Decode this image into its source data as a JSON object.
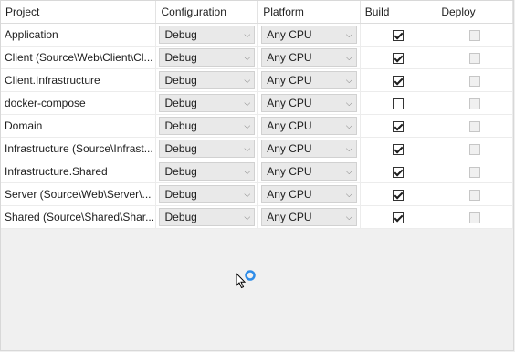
{
  "columns": {
    "project": "Project",
    "configuration": "Configuration",
    "platform": "Platform",
    "build": "Build",
    "deploy": "Deploy"
  },
  "rows": [
    {
      "project": "Application",
      "configuration": "Debug",
      "platform": "Any CPU",
      "build": true,
      "deploy": false
    },
    {
      "project": "Client (Source\\Web\\Client\\Cl...",
      "configuration": "Debug",
      "platform": "Any CPU",
      "build": true,
      "deploy": false
    },
    {
      "project": "Client.Infrastructure",
      "configuration": "Debug",
      "platform": "Any CPU",
      "build": true,
      "deploy": false
    },
    {
      "project": "docker-compose",
      "configuration": "Debug",
      "platform": "Any CPU",
      "build": false,
      "deploy": false
    },
    {
      "project": "Domain",
      "configuration": "Debug",
      "platform": "Any CPU",
      "build": true,
      "deploy": false
    },
    {
      "project": "Infrastructure (Source\\Infrast...",
      "configuration": "Debug",
      "platform": "Any CPU",
      "build": true,
      "deploy": false
    },
    {
      "project": "Infrastructure.Shared",
      "configuration": "Debug",
      "platform": "Any CPU",
      "build": true,
      "deploy": false
    },
    {
      "project": "Server (Source\\Web\\Server\\...",
      "configuration": "Debug",
      "platform": "Any CPU",
      "build": true,
      "deploy": false
    },
    {
      "project": "Shared (Source\\Shared\\Shar...",
      "configuration": "Debug",
      "platform": "Any CPU",
      "build": true,
      "deploy": false
    }
  ],
  "icons": {
    "dropdown": "chevron-down-icon",
    "cursor": "busy-cursor-icon"
  },
  "colors": {
    "busy_ring": "#2e8ce8"
  }
}
